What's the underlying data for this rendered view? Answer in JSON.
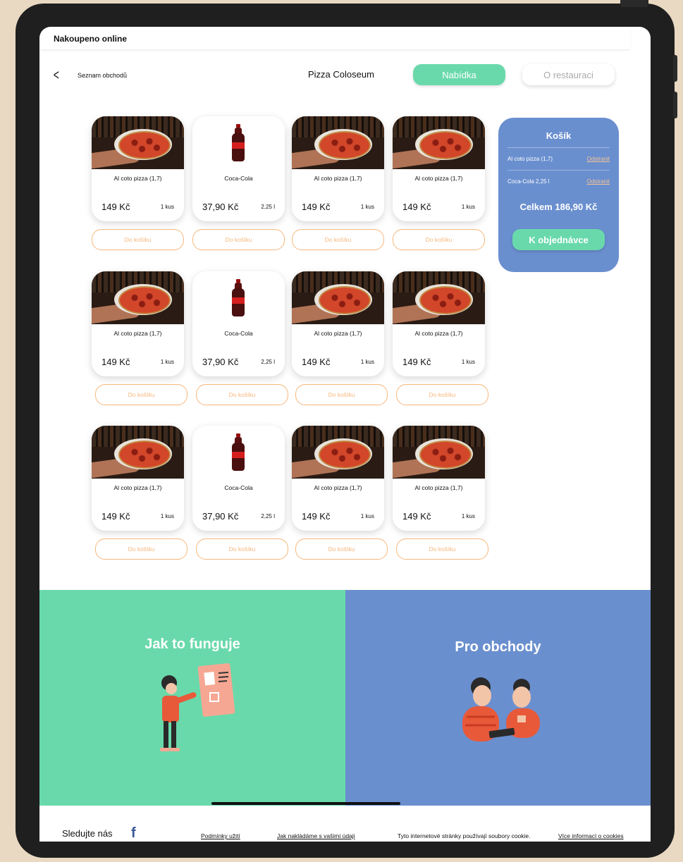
{
  "app": {
    "title": "Nakoupeno online"
  },
  "nav": {
    "back_label": "Seznam obchodů",
    "shop_name": "Pizza Coloseum",
    "tab_active": "Nabídka",
    "tab_inactive": "O restauraci"
  },
  "products": [
    {
      "name": "Al coto pizza (1,7)",
      "price": "149 Kč",
      "unit": "1 kus",
      "type": "pizza"
    },
    {
      "name": "Coca-Cola",
      "price": "37,90 Kč",
      "unit": "2,25 l",
      "type": "cola"
    },
    {
      "name": "Al coto pizza (1,7)",
      "price": "149 Kč",
      "unit": "1 kus",
      "type": "pizza"
    },
    {
      "name": "Al coto pizza (1,7)",
      "price": "149 Kč",
      "unit": "1 kus",
      "type": "pizza"
    }
  ],
  "add_label": "Do košíku",
  "cart": {
    "title": "Košík",
    "items": [
      {
        "name": "Al coto pizza (1,7)",
        "remove": "Odstranit"
      },
      {
        "name": "Coca-Cola 2,25 l",
        "remove": "Odstranit"
      }
    ],
    "total": "Celkem 186,90 Kč",
    "order_label": "K objednávce"
  },
  "promo": {
    "left_title": "Jak to funguje",
    "right_title": "Pro obchody"
  },
  "footer": {
    "follow": "Sledujte nás",
    "terms": "Podmínky užití",
    "data_link": "Jak nakládáme s vašimi údaji",
    "cookie_text": "Tyto internetové stránky používají soubory cookie.",
    "cookie_link": "Více informací o cookies"
  },
  "colors": {
    "green": "#69d9ab",
    "blue": "#6a8fcf",
    "orange": "#f6b77d"
  }
}
